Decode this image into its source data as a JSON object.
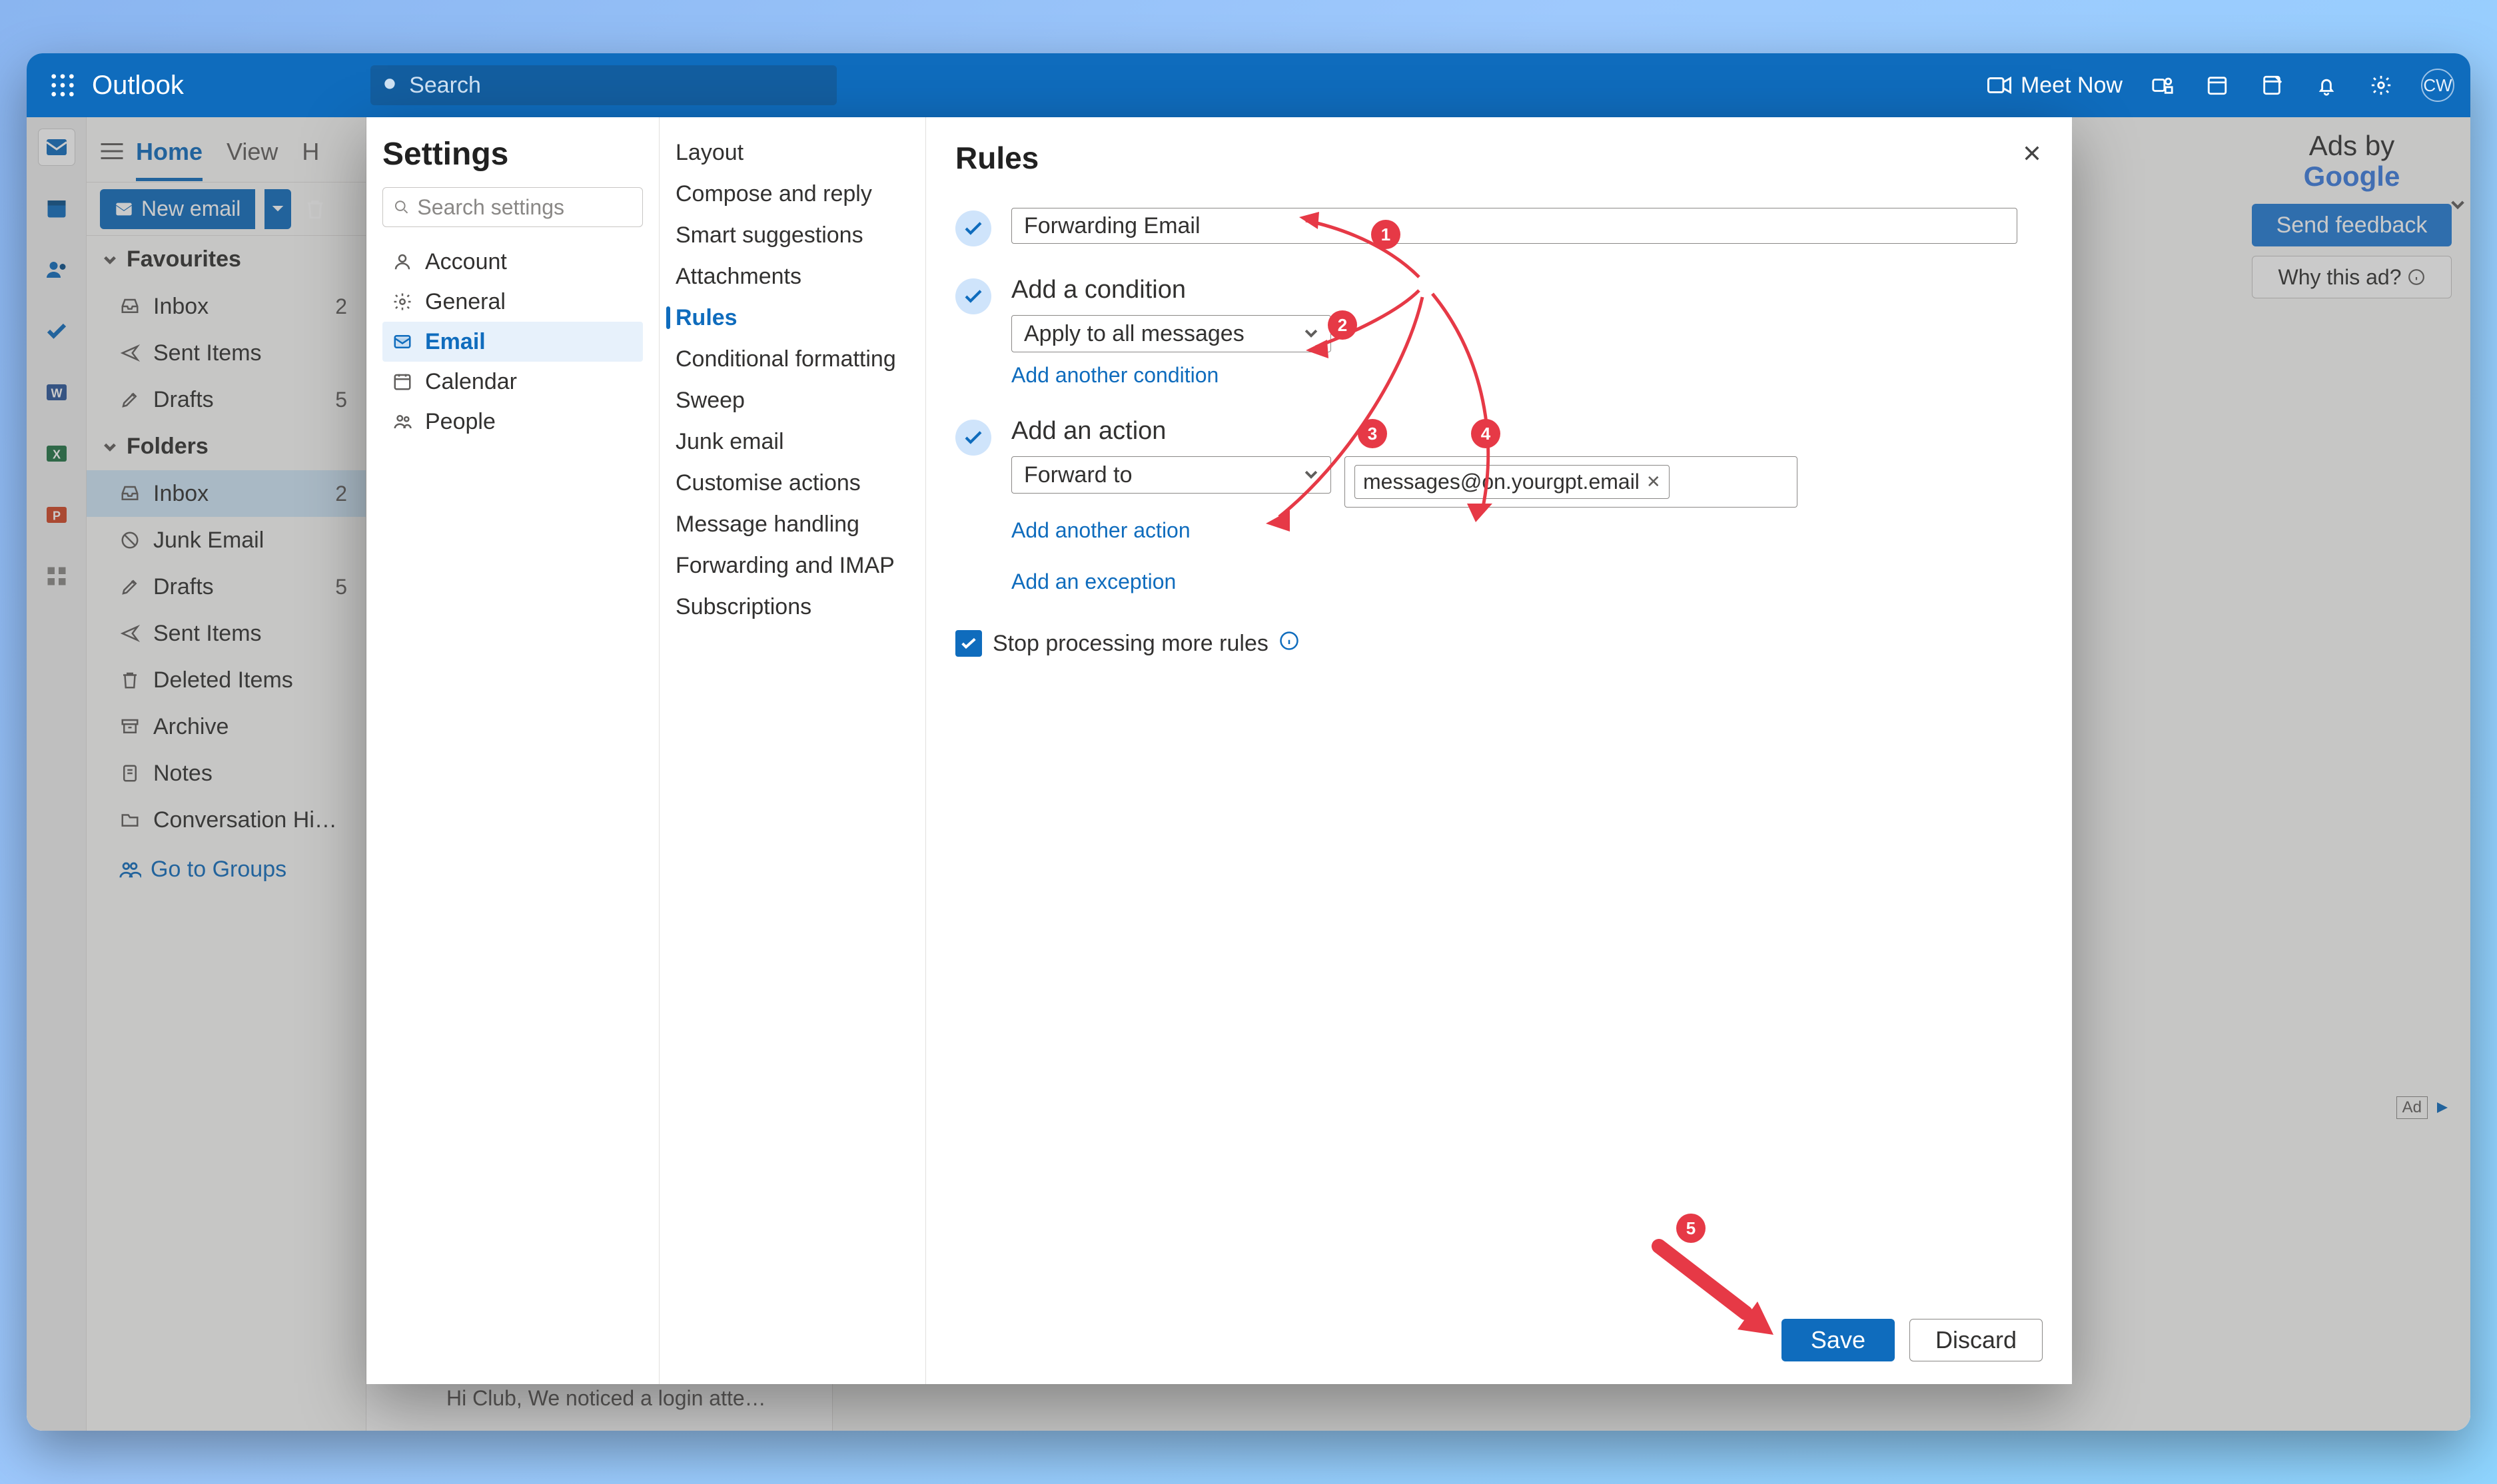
{
  "topbar": {
    "app_title": "Outlook",
    "search_placeholder": "Search",
    "meet_now": "Meet Now",
    "avatar_initials": "CW"
  },
  "tabs": {
    "home": "Home",
    "view": "View",
    "help": "H"
  },
  "buttons": {
    "new_email": "New email"
  },
  "folders": {
    "favourites": "Favourites",
    "folders": "Folders",
    "fav_items": [
      {
        "label": "Inbox",
        "badge": "2"
      },
      {
        "label": "Sent Items",
        "badge": ""
      },
      {
        "label": "Drafts",
        "badge": "5"
      }
    ],
    "items": [
      {
        "label": "Inbox",
        "badge": "2"
      },
      {
        "label": "Junk Email",
        "badge": ""
      },
      {
        "label": "Drafts",
        "badge": "5"
      },
      {
        "label": "Sent Items",
        "badge": ""
      },
      {
        "label": "Deleted Items",
        "badge": ""
      },
      {
        "label": "Archive",
        "badge": ""
      },
      {
        "label": "Notes",
        "badge": ""
      },
      {
        "label": "Conversation Histo…",
        "badge": ""
      }
    ],
    "groups": "Go to Groups"
  },
  "preview_line": "Hi Club, We noticed a login atte…",
  "ads": {
    "line1": "Ads by",
    "line2": "Google",
    "feedback": "Send feedback",
    "why": "Why this ad?",
    "chip": "Ad"
  },
  "settings": {
    "title": "Settings",
    "search_placeholder": "Search settings",
    "cats": [
      "Account",
      "General",
      "Email",
      "Calendar",
      "People"
    ],
    "active_cat": 2,
    "subcats": [
      "Layout",
      "Compose and reply",
      "Smart suggestions",
      "Attachments",
      "Rules",
      "Conditional formatting",
      "Sweep",
      "Junk email",
      "Customise actions",
      "Message handling",
      "Forwarding and IMAP",
      "Subscriptions"
    ],
    "active_sub": 4
  },
  "rules": {
    "title": "Rules",
    "name_value": "Forwarding Email",
    "condition_title": "Add a condition",
    "condition_value": "Apply to all messages",
    "add_condition": "Add another condition",
    "action_title": "Add an action",
    "action_value": "Forward to",
    "email_chip": "messages@on.yourgpt.email",
    "add_action": "Add another action",
    "add_exception": "Add an exception",
    "stop_label": "Stop processing more rules",
    "save": "Save",
    "discard": "Discard"
  },
  "anno_labels": [
    "1",
    "2",
    "3",
    "4",
    "5"
  ]
}
